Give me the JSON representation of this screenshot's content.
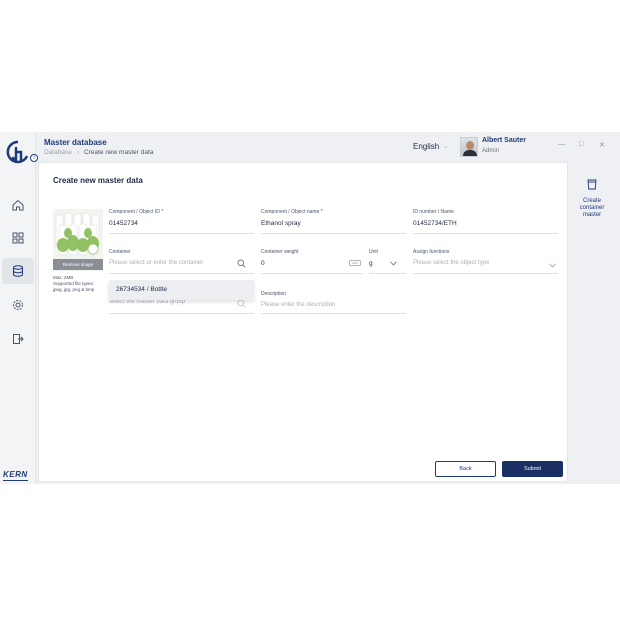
{
  "header": {
    "title": "Master database",
    "breadcrumb": [
      "Database",
      "Create new master data"
    ],
    "language": "English",
    "user_name": "Albert Sauter",
    "user_role": "Admin"
  },
  "brand": {
    "name": "KERN",
    "color": "#1f3a7a"
  },
  "rail": {
    "items": [
      {
        "icon": "home-icon"
      },
      {
        "icon": "grid-icon"
      },
      {
        "icon": "database-icon",
        "active": true
      },
      {
        "icon": "settings-icon"
      },
      {
        "icon": "logout-icon"
      }
    ]
  },
  "form": {
    "title": "Create new master data",
    "image": {
      "remove_label": "Remove image",
      "hint_lines": [
        "Max: 2MB",
        "Supported file types:",
        "jpeg, jpg, png & bmp"
      ]
    },
    "component_id": {
      "label": "Component / Object ID *",
      "value": "01452734"
    },
    "component_name": {
      "label": "Component / Object name *",
      "value": "Ethanol spray"
    },
    "id_number": {
      "label": "ID number / Name",
      "value": "01452734/ETH"
    },
    "container": {
      "label": "Container",
      "placeholder": "Please select or enter the container"
    },
    "container_weight": {
      "label": "Container weight",
      "value": "0"
    },
    "unit": {
      "label": "Unit",
      "value": "g"
    },
    "assign_functions": {
      "label": "Assign functions",
      "placeholder": "Please select the object type"
    },
    "master_group": {
      "placeholder": "select the master data group"
    },
    "description": {
      "label": "Description",
      "placeholder": "Please enter the description"
    },
    "dropdown_option": "26734534 / Bottle",
    "back_label": "Back",
    "submit_label": "Submit"
  },
  "side_panel": {
    "action_label_lines": [
      "Create",
      "container",
      "master"
    ]
  },
  "window_controls": [
    "—",
    "□",
    "✕"
  ]
}
